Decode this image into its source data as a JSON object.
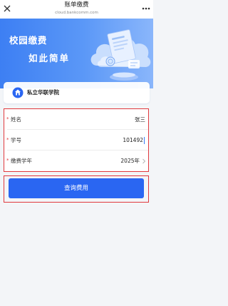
{
  "header": {
    "title": "账单缴费",
    "domain": "cloud.bankcomm.com"
  },
  "icons": {
    "close": "close-icon",
    "more": "more-dots-icon",
    "school": "school-logo-icon",
    "chevron": "chevron-right-icon"
  },
  "hero": {
    "title": "校园缴费",
    "subtitle": "如此简单"
  },
  "school": {
    "name": "私立华联学院"
  },
  "form": {
    "required_mark": "*",
    "fields": [
      {
        "label": "姓名",
        "value": "张三"
      },
      {
        "label": "学号",
        "value": "101492"
      },
      {
        "label": "缴费学年",
        "value": "2025年"
      }
    ]
  },
  "button": {
    "label": "查询费用"
  },
  "colors": {
    "primary": "#2a66f2",
    "highlight_border": "#e0393e",
    "hero_start": "#3d7ff3",
    "hero_end": "#8ab6fb",
    "background": "#f3f5f8"
  }
}
